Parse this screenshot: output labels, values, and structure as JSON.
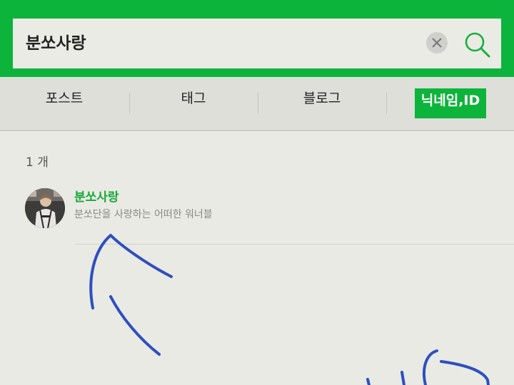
{
  "search": {
    "query": "분쏘사랑",
    "clear_icon": "close-icon",
    "search_icon": "search-icon"
  },
  "tabs": [
    {
      "label": "포스트",
      "active": false
    },
    {
      "label": "태그",
      "active": false
    },
    {
      "label": "블로그",
      "active": false
    },
    {
      "label": "닉네임,ID",
      "active": true
    }
  ],
  "results": {
    "count_text": "1 개",
    "items": [
      {
        "name": "분쏘사랑",
        "description": "분쏘단을 사랑하는 어떠한 워너블",
        "avatar": "profile-photo"
      }
    ]
  },
  "colors": {
    "brand_green": "#0db43b",
    "name_green": "#16a83a",
    "ink_blue": "#2d4fc0",
    "background": "#eaeae4"
  }
}
